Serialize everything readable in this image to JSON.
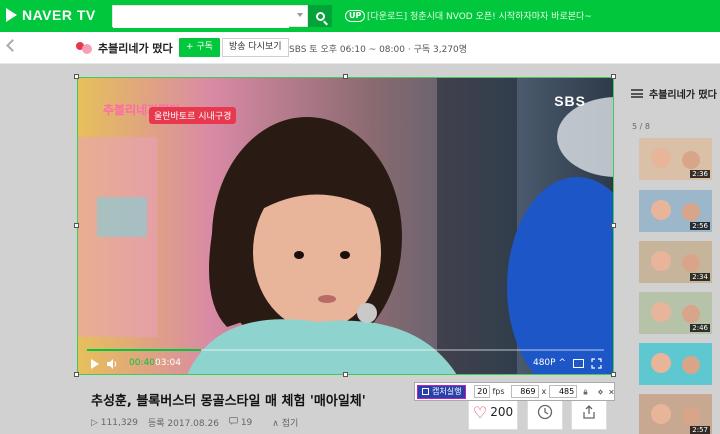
{
  "header": {
    "brand": "NAVER TV",
    "search_value": "",
    "up_badge": "UP",
    "notice": "[다운로드] 청춘시대 NVOD 오픈! 시작하자마자 바로본다~"
  },
  "program": {
    "title": "추블리네가 떴다",
    "subscribe_label": "+ 구독",
    "replay_label": "방송 다시보기",
    "info": "SBS   토 오후 06:10 ~ 08:00  ·  구독 3,270명"
  },
  "player": {
    "broadcaster": "SBS",
    "show_logo": "추블리네가떴다",
    "caption": "울란바토르 시내구경",
    "current_time": "00:40",
    "duration": "03:04",
    "progress_fraction": 0.22,
    "quality": "480P ^"
  },
  "capture": {
    "button_label": "캡처실행",
    "fps_value": "20",
    "fps_label": "fps",
    "width_value": "869",
    "x_label": "x",
    "height_value": "485"
  },
  "video": {
    "title": "추성훈, 블록버스터 몽골스타일 매 체험 '매아일체'",
    "views": "▷ 111,329",
    "date": "등록 2017.08.26",
    "comments": "19",
    "fold_label": "∧ 접기",
    "likes": "200"
  },
  "sidebar": {
    "title": "추블리네가 떴다",
    "count": "5 / 8",
    "items": [
      {
        "duration": "2:36",
        "color": "#d9c0a6"
      },
      {
        "duration": "2:56",
        "color": "#9bb7c9"
      },
      {
        "duration": "2:34",
        "color": "#c7b59b"
      },
      {
        "duration": "2:46",
        "color": "#b6c3a8"
      },
      {
        "duration": "",
        "color": "#5ec7d0"
      },
      {
        "duration": "2:57",
        "color": "#c9a892"
      }
    ]
  }
}
